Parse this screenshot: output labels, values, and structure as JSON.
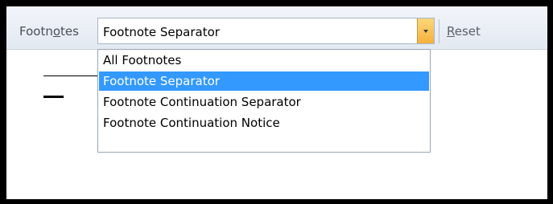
{
  "toolbar": {
    "footnotes_label_pre": "Footn",
    "footnotes_label_mnemonic": "o",
    "footnotes_label_post": "tes",
    "combo_value": "Footnote Separator",
    "reset_label_mnemonic": "R",
    "reset_label_post": "eset"
  },
  "dropdown": {
    "items": [
      {
        "label": "All Footnotes"
      },
      {
        "label": "Footnote Separator"
      },
      {
        "label": "Footnote Continuation Separator"
      },
      {
        "label": "Footnote Continuation Notice"
      }
    ]
  },
  "colors": {
    "selection": "#3399ff",
    "arrow_button": "#f5b13c",
    "frame": "#000000"
  },
  "icons": {
    "combo_arrow": "chevron-down-icon"
  },
  "state": {
    "selected_index": 1
  }
}
